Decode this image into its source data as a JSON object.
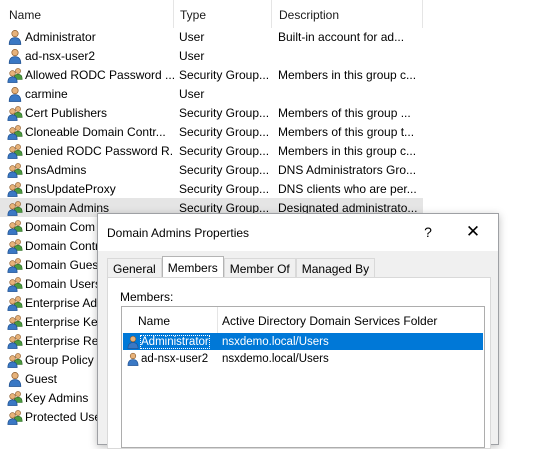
{
  "list": {
    "headers": {
      "name": "Name",
      "type": "Type",
      "description": "Description"
    },
    "rows": [
      {
        "name": "Administrator",
        "type": "User",
        "description": "Built-in account for ad...",
        "icon": "user-icon"
      },
      {
        "name": "ad-nsx-user2",
        "type": "User",
        "description": "",
        "icon": "user-icon"
      },
      {
        "name": "Allowed RODC Password ...",
        "type": "Security Group...",
        "description": "Members in this group c...",
        "icon": "group-icon"
      },
      {
        "name": "carmine",
        "type": "User",
        "description": "",
        "icon": "user-icon"
      },
      {
        "name": "Cert Publishers",
        "type": "Security Group...",
        "description": "Members of this group ...",
        "icon": "group-icon"
      },
      {
        "name": "Cloneable Domain Contr...",
        "type": "Security Group...",
        "description": "Members of this group t...",
        "icon": "group-icon"
      },
      {
        "name": "Denied RODC Password R...",
        "type": "Security Group...",
        "description": "Members in this group c...",
        "icon": "group-icon"
      },
      {
        "name": "DnsAdmins",
        "type": "Security Group...",
        "description": "DNS Administrators Gro...",
        "icon": "group-icon"
      },
      {
        "name": "DnsUpdateProxy",
        "type": "Security Group...",
        "description": "DNS clients who are per...",
        "icon": "group-icon"
      },
      {
        "name": "Domain Admins",
        "type": "Security Group...",
        "description": "Designated administrato...",
        "icon": "group-icon",
        "selected": true
      },
      {
        "name": "Domain Com",
        "type": "",
        "description": "",
        "icon": "group-icon"
      },
      {
        "name": "Domain Contr",
        "type": "",
        "description": "",
        "icon": "group-icon"
      },
      {
        "name": "Domain Guest",
        "type": "",
        "description": "",
        "icon": "group-icon"
      },
      {
        "name": "Domain Users",
        "type": "",
        "description": "",
        "icon": "group-icon"
      },
      {
        "name": "Enterprise Adr",
        "type": "",
        "description": "",
        "icon": "group-icon"
      },
      {
        "name": "Enterprise Key",
        "type": "",
        "description": "",
        "icon": "group-icon"
      },
      {
        "name": "Enterprise Rea",
        "type": "",
        "description": "",
        "icon": "group-icon"
      },
      {
        "name": "Group Policy C",
        "type": "",
        "description": "",
        "icon": "group-icon"
      },
      {
        "name": "Guest",
        "type": "",
        "description": "",
        "icon": "user-icon"
      },
      {
        "name": "Key Admins",
        "type": "",
        "description": "",
        "icon": "group-icon"
      },
      {
        "name": "Protected Use",
        "type": "",
        "description": "",
        "icon": "group-icon"
      }
    ]
  },
  "dialog": {
    "title": "Domain Admins Properties",
    "help_label": "?",
    "close_label": "✕",
    "tabs": [
      {
        "label": "General",
        "active": false
      },
      {
        "label": "Members",
        "active": true
      },
      {
        "label": "Member Of",
        "active": false
      },
      {
        "label": "Managed By",
        "active": false
      }
    ],
    "members_label": "Members:",
    "grid": {
      "headers": {
        "name": "Name",
        "folder": "Active Directory Domain Services Folder"
      },
      "rows": [
        {
          "name": "Administrator",
          "folder": "nsxdemo.local/Users",
          "selected": true
        },
        {
          "name": "ad-nsx-user2",
          "folder": "nsxdemo.local/Users",
          "selected": false
        }
      ]
    }
  },
  "colors": {
    "selection": "#0078d7",
    "list_selected": "#e5e5e5"
  }
}
